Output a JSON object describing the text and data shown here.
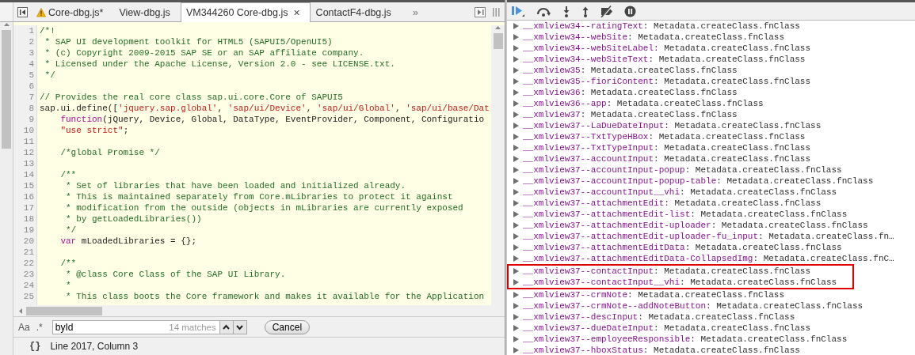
{
  "tabs": [
    {
      "label": "Core-dbg.js*",
      "warning": true,
      "selected": false
    },
    {
      "label": "View-dbg.js",
      "warning": false,
      "selected": false
    },
    {
      "label": "VM344260 Core-dbg.js",
      "warning": false,
      "selected": true,
      "close": "×"
    },
    {
      "label": "ContactF4-dbg.js",
      "warning": false,
      "selected": false
    }
  ],
  "tab_overflow": "»",
  "code_lines": [
    {
      "number": "1",
      "tokens": [
        {
          "kind": "comment",
          "text": "/*!"
        }
      ]
    },
    {
      "number": "2",
      "tokens": [
        {
          "kind": "comment",
          "text": " * SAP UI development toolkit for HTML5 (SAPUI5/OpenUI5)"
        }
      ]
    },
    {
      "number": "3",
      "tokens": [
        {
          "kind": "comment",
          "text": " * (c) Copyright 2009-2015 SAP SE or an SAP affiliate company."
        }
      ]
    },
    {
      "number": "4",
      "tokens": [
        {
          "kind": "comment",
          "text": " * Licensed under the Apache License, Version 2.0 - see LICENSE.txt."
        }
      ]
    },
    {
      "number": "5",
      "tokens": [
        {
          "kind": "comment",
          "text": " */"
        }
      ]
    },
    {
      "number": "6"
    },
    {
      "number": "7",
      "tokens": [
        {
          "kind": "comment",
          "text": "// Provides the real core class sap.ui.core.Core of SAPUI5"
        }
      ]
    },
    {
      "number": "8",
      "tokens": [
        {
          "kind": "plain",
          "text": "sap.ui.define(["
        },
        {
          "kind": "string",
          "text": "'jquery.sap.global'"
        },
        {
          "kind": "plain",
          "text": ", "
        },
        {
          "kind": "string",
          "text": "'sap/ui/Device'"
        },
        {
          "kind": "plain",
          "text": ", "
        },
        {
          "kind": "string",
          "text": "'sap/ui/Global'"
        },
        {
          "kind": "plain",
          "text": ", "
        },
        {
          "kind": "string",
          "text": "'sap/ui/base/Dat"
        }
      ]
    },
    {
      "number": "9",
      "tokens": [
        {
          "kind": "keyword",
          "text": "    function"
        },
        {
          "kind": "plain",
          "text": "(jQuery, Device, Global, DataType, EventProvider, Component, Configuratio"
        }
      ]
    },
    {
      "number": "10",
      "tokens": [
        {
          "kind": "string",
          "text": "    \"use strict\""
        },
        {
          "kind": "plain",
          "text": ";"
        }
      ]
    },
    {
      "number": "11"
    },
    {
      "number": "12",
      "tokens": [
        {
          "kind": "comment",
          "text": "    /*global Promise */"
        }
      ]
    },
    {
      "number": "13"
    },
    {
      "number": "14",
      "tokens": [
        {
          "kind": "comment",
          "text": "    /**"
        }
      ]
    },
    {
      "number": "15",
      "tokens": [
        {
          "kind": "comment",
          "text": "     * Set of libraries that have been loaded and initialized already."
        }
      ]
    },
    {
      "number": "16",
      "tokens": [
        {
          "kind": "comment",
          "text": "     * This is maintained separately from Core.mLibraries to protect it against"
        }
      ]
    },
    {
      "number": "17",
      "tokens": [
        {
          "kind": "comment",
          "text": "     * modification from the outside (objects in mLibraries are currently exposed"
        }
      ]
    },
    {
      "number": "18",
      "tokens": [
        {
          "kind": "comment",
          "text": "     * by getLoadedLibraries())"
        }
      ]
    },
    {
      "number": "19",
      "tokens": [
        {
          "kind": "comment",
          "text": "     */"
        }
      ]
    },
    {
      "number": "20",
      "tokens": [
        {
          "kind": "keyword",
          "text": "    var"
        },
        {
          "kind": "plain",
          "text": " mLoadedLibraries = {};"
        }
      ]
    },
    {
      "number": "21"
    },
    {
      "number": "22",
      "tokens": [
        {
          "kind": "comment",
          "text": "    /**"
        }
      ]
    },
    {
      "number": "23",
      "tokens": [
        {
          "kind": "comment",
          "text": "     * @class Core Class of the SAP UI Library."
        }
      ]
    },
    {
      "number": "24",
      "tokens": [
        {
          "kind": "comment",
          "text": "     *"
        }
      ]
    },
    {
      "number": "25",
      "tokens": [
        {
          "kind": "comment",
          "text": "     * This class boots the Core framework and makes it available for the Application"
        }
      ]
    }
  ],
  "search": {
    "case_toggle": "Aa",
    "regex_toggle": ".*",
    "value": "byId",
    "match_count": "14 matches",
    "cancel": "Cancel"
  },
  "status_bar": {
    "pretty_print": "{}",
    "position": "Line 2017, Column 3"
  },
  "scope_rows": [
    {
      "name": "__xmlview34--ratingText",
      "value": ": Metadata.createClass.fnClass",
      "highlighted": false
    },
    {
      "name": "__xmlview34--webSite",
      "value": ": Metadata.createClass.fnClass",
      "highlighted": false
    },
    {
      "name": "__xmlview34--webSiteLabel",
      "value": ": Metadata.createClass.fnClass",
      "highlighted": false
    },
    {
      "name": "__xmlview34--webSiteText",
      "value": ": Metadata.createClass.fnClass",
      "highlighted": false
    },
    {
      "name": "__xmlview35",
      "value": ": Metadata.createClass.fnClass",
      "highlighted": false
    },
    {
      "name": "__xmlview35--fioriContent",
      "value": ": Metadata.createClass.fnClass",
      "highlighted": false
    },
    {
      "name": "__xmlview36",
      "value": ": Metadata.createClass.fnClass",
      "highlighted": false
    },
    {
      "name": "__xmlview36--app",
      "value": ": Metadata.createClass.fnClass",
      "highlighted": false
    },
    {
      "name": "__xmlview37",
      "value": ": Metadata.createClass.fnClass",
      "highlighted": false
    },
    {
      "name": "__xmlview37--LaDueDateInput",
      "value": ": Metadata.createClass.fnClass",
      "highlighted": false
    },
    {
      "name": "__xmlview37--TxtTypeHBox",
      "value": ": Metadata.createClass.fnClass",
      "highlighted": false
    },
    {
      "name": "__xmlview37--TxtTypeInput",
      "value": ": Metadata.createClass.fnClass",
      "highlighted": false
    },
    {
      "name": "__xmlview37--accountInput",
      "value": ": Metadata.createClass.fnClass",
      "highlighted": false
    },
    {
      "name": "__xmlview37--accountInput-popup",
      "value": ": Metadata.createClass.fnClass",
      "highlighted": false
    },
    {
      "name": "__xmlview37--accountInput-popup-table",
      "value": ": Metadata.createClass.fnClass",
      "highlighted": false
    },
    {
      "name": "__xmlview37--accountInput__vhi",
      "value": ": Metadata.createClass.fnClass",
      "highlighted": false
    },
    {
      "name": "__xmlview37--attachmentEdit",
      "value": ": Metadata.createClass.fnClass",
      "highlighted": false
    },
    {
      "name": "__xmlview37--attachmentEdit-list",
      "value": ": Metadata.createClass.fnClass",
      "highlighted": false
    },
    {
      "name": "__xmlview37--attachmentEdit-uploader",
      "value": ": Metadata.createClass.fnClass",
      "highlighted": false
    },
    {
      "name": "__xmlview37--attachmentEdit-uploader-fu_input",
      "value": ": Metadata.createClass.fn…",
      "highlighted": false
    },
    {
      "name": "__xmlview37--attachmentEditData",
      "value": ": Metadata.createClass.fnClass",
      "highlighted": false
    },
    {
      "name": "__xmlview37--attachmentEditData-CollapsedImg",
      "value": ": Metadata.createClass.fnC…",
      "highlighted": false
    },
    {
      "name": "__xmlview37--contactInput",
      "value": ": Metadata.createClass.fnClass",
      "highlighted": true
    },
    {
      "name": "__xmlview37--contactInput__vhi",
      "value": ": Metadata.createClass.fnClass",
      "highlighted": true
    },
    {
      "name": "__xmlview37--crmNote",
      "value": ": Metadata.createClass.fnClass",
      "highlighted": false
    },
    {
      "name": "__xmlview37--crmNote--addNoteButton",
      "value": ": Metadata.createClass.fnClass",
      "highlighted": false
    },
    {
      "name": "__xmlview37--descInput",
      "value": ": Metadata.createClass.fnClass",
      "highlighted": false
    },
    {
      "name": "__xmlview37--dueDateInput",
      "value": ": Metadata.createClass.fnClass",
      "highlighted": false
    },
    {
      "name": "__xmlview37--employeeResponsible",
      "value": ": Metadata.createClass.fnClass",
      "highlighted": false
    },
    {
      "name": "__xmlview37--hboxStatus",
      "value": ": Metadata.createClass.fnClass",
      "highlighted": false
    }
  ]
}
